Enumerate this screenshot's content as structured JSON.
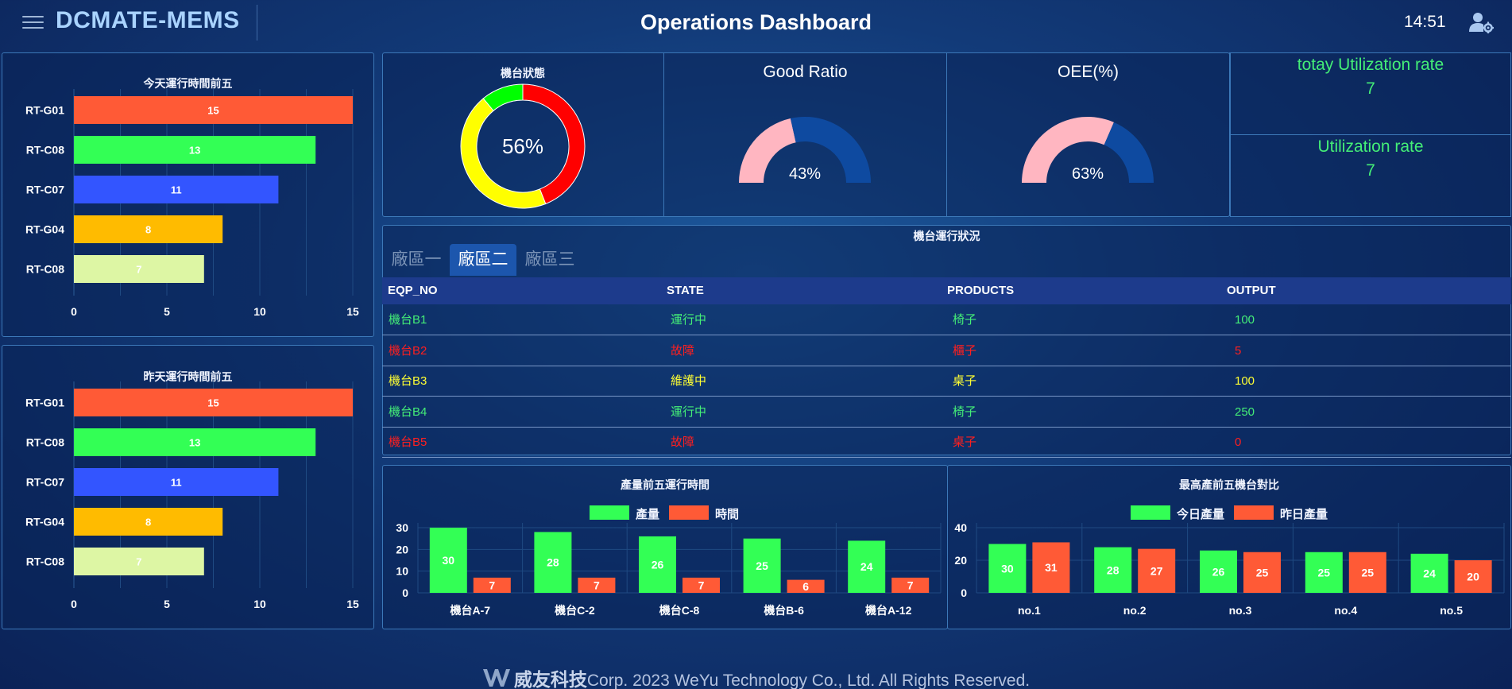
{
  "header": {
    "brand": "DCMATE-MEMS",
    "title": "Operations Dashboard",
    "time": "14:51",
    "menu_icon": "hamburger-menu-icon",
    "user_icon": "user-settings-icon"
  },
  "colors": {
    "red": "#ff5a36",
    "green": "#33ff55",
    "blue": "#3355ff",
    "orange": "#ffbb00",
    "lightgreen": "#ddf6a4",
    "status_running": "#44ee77",
    "status_fault": "#ff1f1f",
    "status_maintenance": "#ffff33",
    "gauge_fill": "#ffb6c1",
    "gauge_rest": "#0e4aa0"
  },
  "today_top5": {
    "title": "今天運行時間前五",
    "chart_data": {
      "type": "bar",
      "orientation": "horizontal",
      "categories": [
        "RT-G01",
        "RT-C08",
        "RT-C07",
        "RT-G04",
        "RT-C08"
      ],
      "values": [
        15,
        13,
        11,
        8,
        7
      ],
      "bar_colors": [
        "#ff5a36",
        "#33ff55",
        "#3355ff",
        "#ffbb00",
        "#ddf6a4"
      ],
      "xlim": [
        0,
        15
      ],
      "xticks": [
        "0",
        "5",
        "10",
        "15"
      ]
    }
  },
  "yesterday_top5": {
    "title": "昨天運行時間前五",
    "chart_data": {
      "type": "bar",
      "orientation": "horizontal",
      "categories": [
        "RT-G01",
        "RT-C08",
        "RT-C07",
        "RT-G04",
        "RT-C08"
      ],
      "values": [
        15,
        13,
        11,
        8,
        7
      ],
      "bar_colors": [
        "#ff5a36",
        "#33ff55",
        "#3355ff",
        "#ffbb00",
        "#ddf6a4"
      ],
      "xlim": [
        0,
        15
      ],
      "xticks": [
        "0",
        "5",
        "10",
        "15"
      ]
    }
  },
  "machine_status": {
    "title": "機台狀態",
    "center_label": "56%",
    "chart_data": {
      "type": "pie",
      "donut": true,
      "values": [
        44,
        45,
        11
      ],
      "colors": [
        "#ff0000",
        "#ffff00",
        "#00ff00"
      ]
    }
  },
  "good_ratio": {
    "title": "Good Ratio",
    "value_label": "43%",
    "value": 43
  },
  "oee": {
    "title": "OEE(%)",
    "value_label": "63%",
    "value": 63
  },
  "utilization": {
    "today_label": "totay Utilization rate",
    "today_value": "7",
    "label": "Utilization rate",
    "value": "7"
  },
  "machine_table": {
    "title": "機台運行狀況",
    "tabs": [
      {
        "label": "廠區一",
        "active": false
      },
      {
        "label": "廠區二",
        "active": true
      },
      {
        "label": "廠區三",
        "active": false
      }
    ],
    "columns": [
      "EQP_NO",
      "STATE",
      "PRODUCTS",
      "OUTPUT"
    ],
    "rows": [
      {
        "eqp": "機台B1",
        "state": "運行中",
        "product": "椅子",
        "output": "100",
        "status": "running"
      },
      {
        "eqp": "機台B2",
        "state": "故障",
        "product": "櫃子",
        "output": "5",
        "status": "fault"
      },
      {
        "eqp": "機台B3",
        "state": "維護中",
        "product": "桌子",
        "output": "100",
        "status": "maintenance"
      },
      {
        "eqp": "機台B4",
        "state": "運行中",
        "product": "椅子",
        "output": "250",
        "status": "running"
      },
      {
        "eqp": "機台B5",
        "state": "故障",
        "product": "桌子",
        "output": "0",
        "status": "fault"
      }
    ]
  },
  "output_runtime": {
    "title": "產量前五運行時間",
    "chart_data": {
      "type": "bar",
      "categories": [
        "機台A-7",
        "機台C-2",
        "機台C-8",
        "機台B-6",
        "機台A-12"
      ],
      "series": [
        {
          "name": "產量",
          "values": [
            30,
            28,
            26,
            25,
            24
          ],
          "color": "#33ff55"
        },
        {
          "name": "時間",
          "values": [
            7,
            7,
            7,
            6,
            7
          ],
          "color": "#ff5a36"
        }
      ],
      "ylim": [
        0,
        30
      ],
      "yticks": [
        "0",
        "10",
        "20",
        "30"
      ]
    }
  },
  "top5_compare": {
    "title": "最高產前五機台對比",
    "chart_data": {
      "type": "bar",
      "categories": [
        "no.1",
        "no.2",
        "no.3",
        "no.4",
        "no.5"
      ],
      "series": [
        {
          "name": "今日產量",
          "values": [
            30,
            28,
            26,
            25,
            24
          ],
          "color": "#33ff55"
        },
        {
          "name": "昨日產量",
          "values": [
            31,
            27,
            25,
            25,
            20
          ],
          "color": "#ff5a36"
        }
      ],
      "ylim": [
        0,
        40
      ],
      "yticks": [
        "0",
        "20",
        "40"
      ]
    }
  },
  "footer": {
    "logo_icon": "weyu-logo-icon",
    "brand": "威友科技",
    "text": "Corp. 2023 WeYu Technology Co., Ltd. All Rights Reserved."
  }
}
